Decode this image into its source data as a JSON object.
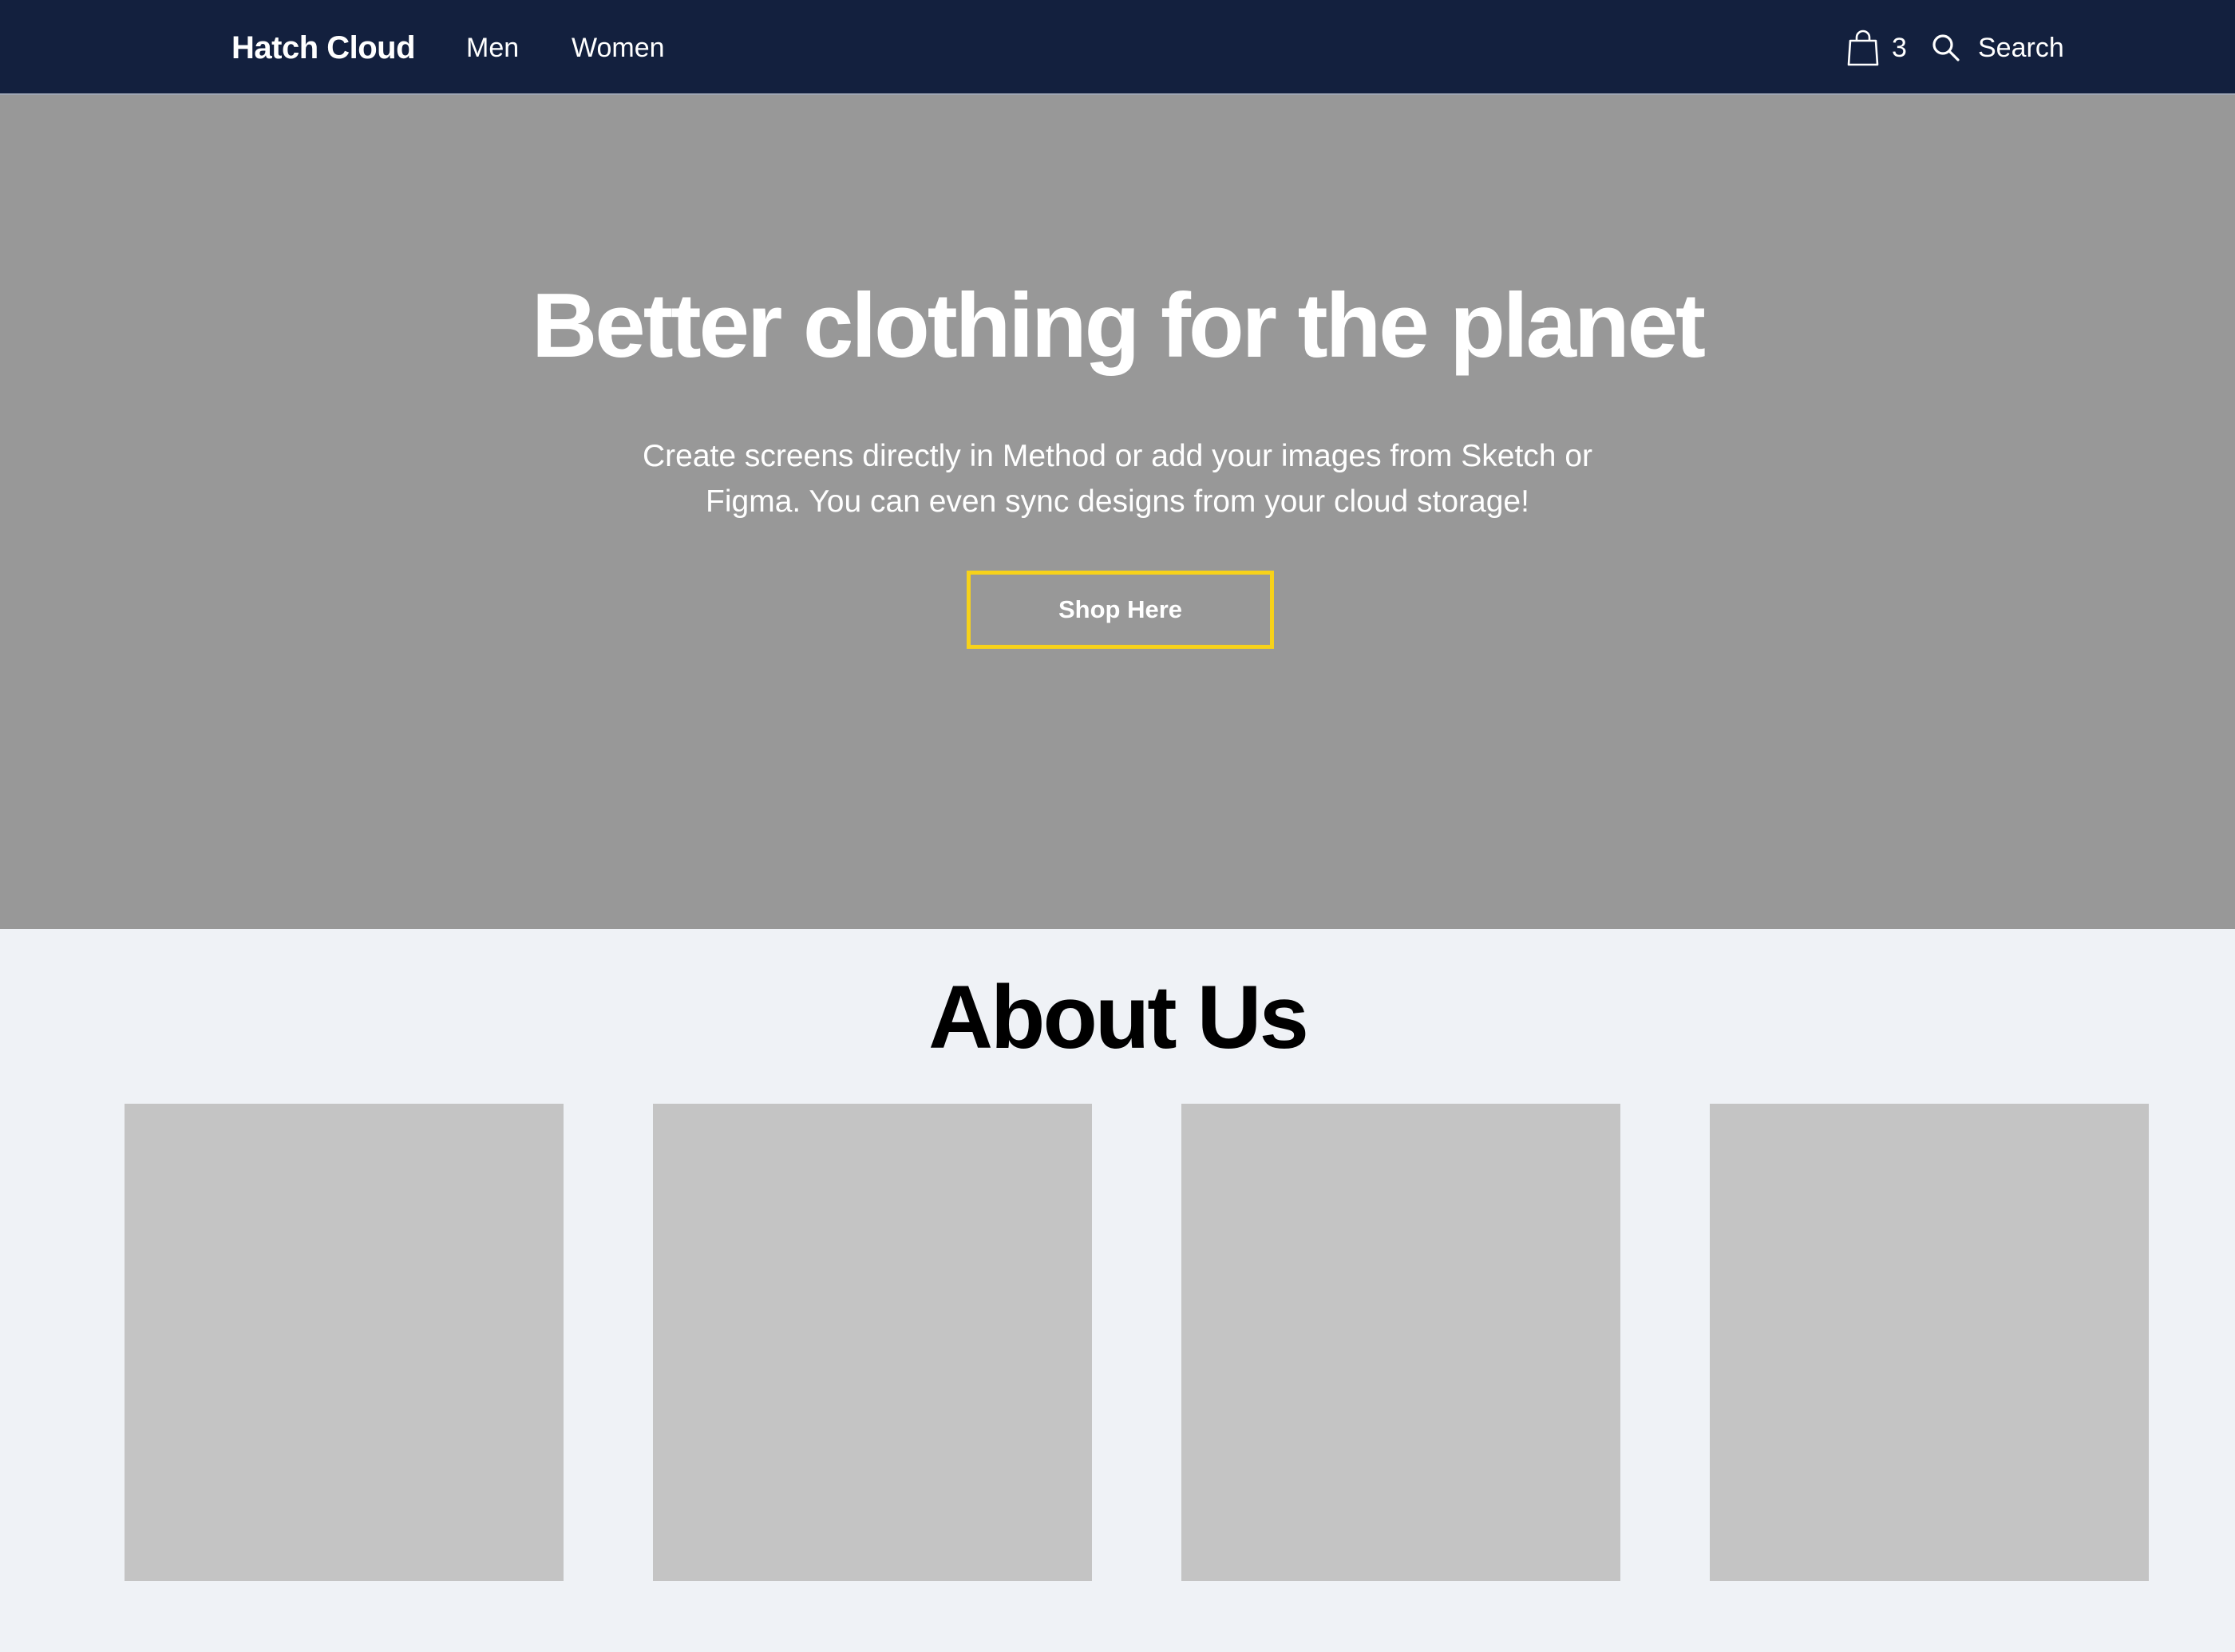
{
  "navbar": {
    "brand": "Hatch Cloud",
    "links": [
      "Men",
      "Women"
    ],
    "cart_icon": "shopping-bag-icon",
    "cart_count": "3",
    "search_icon": "search-icon",
    "search_label": "Search",
    "background_color": "#13203e"
  },
  "hero": {
    "title": "Better clothing for the planet",
    "subtitle": "Create screens directly in Method or add your images from Sketch or Figma. You can even sync designs from your cloud storage!",
    "button_label": "Shop Here",
    "button_border_color": "#f7d21a",
    "background_color": "#989898"
  },
  "about": {
    "title": "About Us",
    "card_count": 4,
    "card_color": "#c4c4c4"
  }
}
